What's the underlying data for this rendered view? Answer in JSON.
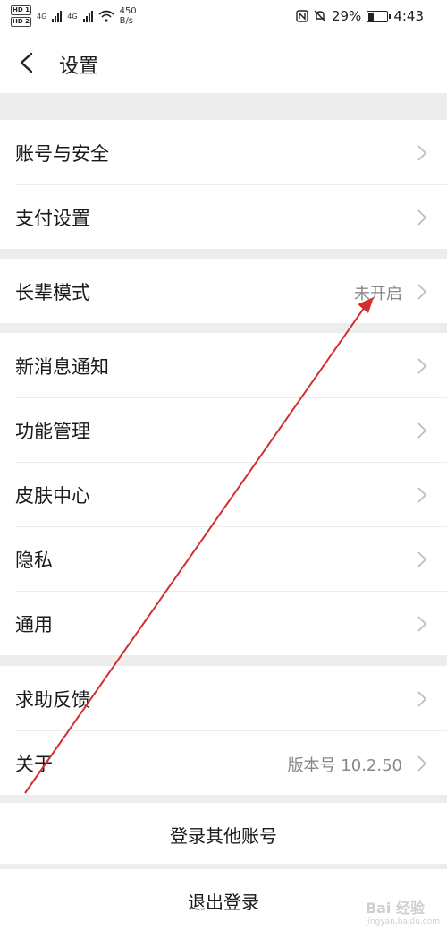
{
  "status_bar": {
    "hd1": "HD 1",
    "hd2": "HD 2",
    "net1": "4G",
    "net2": "4G",
    "speed_value": "450",
    "speed_unit": "B/s",
    "battery": "29%",
    "battery_level": 0.29,
    "time": "4:43"
  },
  "header": {
    "title": "设置"
  },
  "groups": [
    {
      "items": [
        {
          "label": "账号与安全"
        },
        {
          "label": "支付设置"
        }
      ]
    },
    {
      "items": [
        {
          "label": "长辈模式",
          "value": "未开启"
        }
      ]
    },
    {
      "items": [
        {
          "label": "新消息通知"
        },
        {
          "label": "功能管理"
        },
        {
          "label": "皮肤中心"
        },
        {
          "label": "隐私"
        },
        {
          "label": "通用"
        }
      ]
    },
    {
      "items": [
        {
          "label": "求助反馈"
        },
        {
          "label": "关于",
          "value": "版本号 10.2.50"
        }
      ]
    }
  ],
  "actions": {
    "switch_account": "登录其他账号",
    "logout": "退出登录"
  },
  "watermark": {
    "text": "Bai 经验",
    "sub": "jingyan.baidu.com"
  },
  "annotation": {
    "color": "#d32f2f"
  }
}
